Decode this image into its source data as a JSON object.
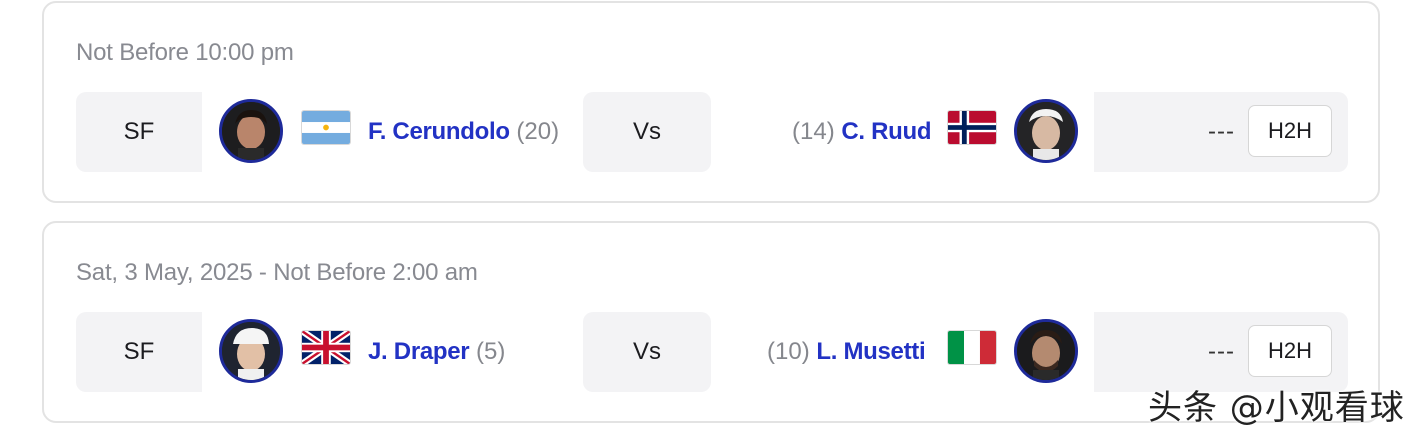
{
  "matches": [
    {
      "time": "Not Before 10:00 pm",
      "round": "SF",
      "player1": {
        "name": "F. Cerundolo",
        "seed": "(20)",
        "flag": "argentina-flag"
      },
      "vs": "Vs",
      "player2": {
        "seed": "(14)",
        "name": "C. Ruud",
        "flag": "norway-flag"
      },
      "score": "---",
      "h2h": "H2H"
    },
    {
      "time": "Sat, 3 May, 2025 - Not Before 2:00 am",
      "round": "SF",
      "player1": {
        "name": "J. Draper",
        "seed": "(5)",
        "flag": "uk-flag"
      },
      "vs": "Vs",
      "player2": {
        "seed": "(10)",
        "name": "L. Musetti",
        "flag": "italy-flag"
      },
      "score": "---",
      "h2h": "H2H"
    }
  ],
  "watermark": "头条 @小观看球",
  "colors": {
    "player_name": "#2232c4",
    "avatar_border": "#1e2a9a",
    "muted": "#888a91"
  }
}
